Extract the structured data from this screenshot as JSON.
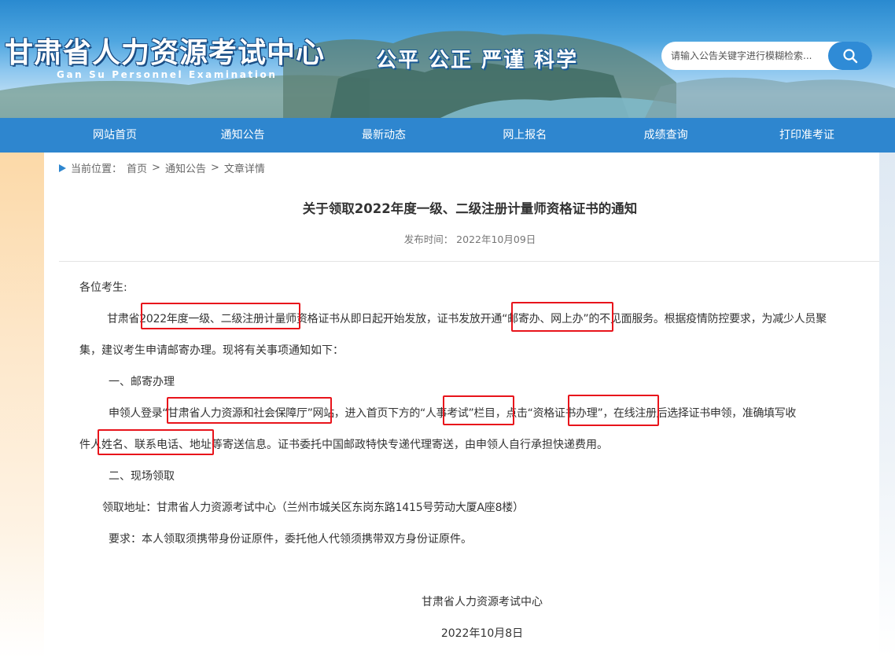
{
  "header": {
    "logo_cn": "甘肃省人力资源考试中心",
    "logo_en": "Gan Su Personnel Examination",
    "slogan": "公平 公正 严谨 科学",
    "search_placeholder": "请输入公告关键字进行模糊检索..."
  },
  "nav": {
    "items": [
      "网站首页",
      "通知公告",
      "最新动态",
      "网上报名",
      "成绩查询",
      "打印准考证"
    ]
  },
  "breadcrumb": {
    "label": "当前位置：",
    "home": "首页",
    "sep": ">",
    "section": "通知公告",
    "current": "文章详情"
  },
  "article": {
    "title": "关于领取2022年度一级、二级注册计量师资格证书的通知",
    "pubdate": "发布时间： 2022年10月09日",
    "greeting": "各位考生:",
    "p1_line1": "甘肃省2022年度一级、二级注册计量师资格证书从即日起开始发放，证书发放开通“邮寄办、网上办”的不见面服务。根据疫情防控要求，为减少人员聚",
    "p1_line2": "集，建议考生申请邮寄办理。现将有关事项通知如下：",
    "h1": "一、邮寄办理",
    "p2_line1": "申领人登录“甘肃省人力资源和社会保障厅”网站，进入首页下方的“人事考试”栏目，点击“资格证书办理”，在线注册后选择证书申领，准确填写收",
    "p2_line2": "件人姓名、联系电话、地址等寄送信息。证书委托中国邮政特快专递代理寄送，由申领人自行承担快递费用。",
    "h2": "二、现场领取",
    "address": "领取地址：甘肃省人力资源考试中心（兰州市城关区东岗东路1415号劳动大厦A座8楼）",
    "requirement": "要求：本人领取须携带身份证原件，委托他人代领须携带双方身份证原件。",
    "sign_org": "甘肃省人力资源考试中心",
    "sign_date": "2022年10月8日"
  },
  "colors": {
    "nav_bg": "#2e86cf",
    "highlight_box": "#e8141b"
  }
}
